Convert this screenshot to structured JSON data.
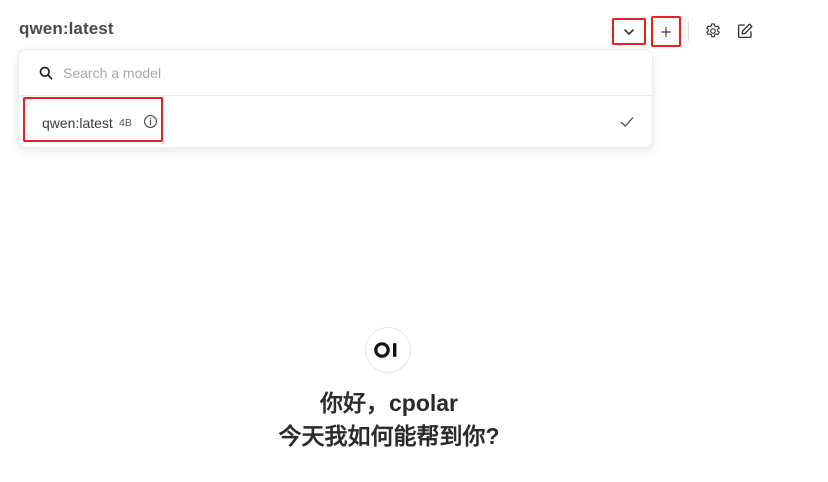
{
  "header": {
    "model_title": "qwen:latest"
  },
  "model_selector": {
    "search_placeholder": "Search a model",
    "options": [
      {
        "name": "qwen:latest",
        "size": "4B",
        "selected": true
      }
    ]
  },
  "icons": {
    "chevron": "chevron-down-icon",
    "plus": "plus-icon",
    "gear": "gear-icon",
    "edit": "edit-icon",
    "search": "search-icon",
    "info": "info-icon",
    "check": "check-icon",
    "logo": "openwebui-logo"
  },
  "welcome": {
    "greeting": "你好，cpolar",
    "subtitle": "今天我如何能帮到你?"
  },
  "colors": {
    "highlight_annotation": "#e62020",
    "text_primary": "#2b2b2b",
    "placeholder": "#a8a8a8"
  }
}
